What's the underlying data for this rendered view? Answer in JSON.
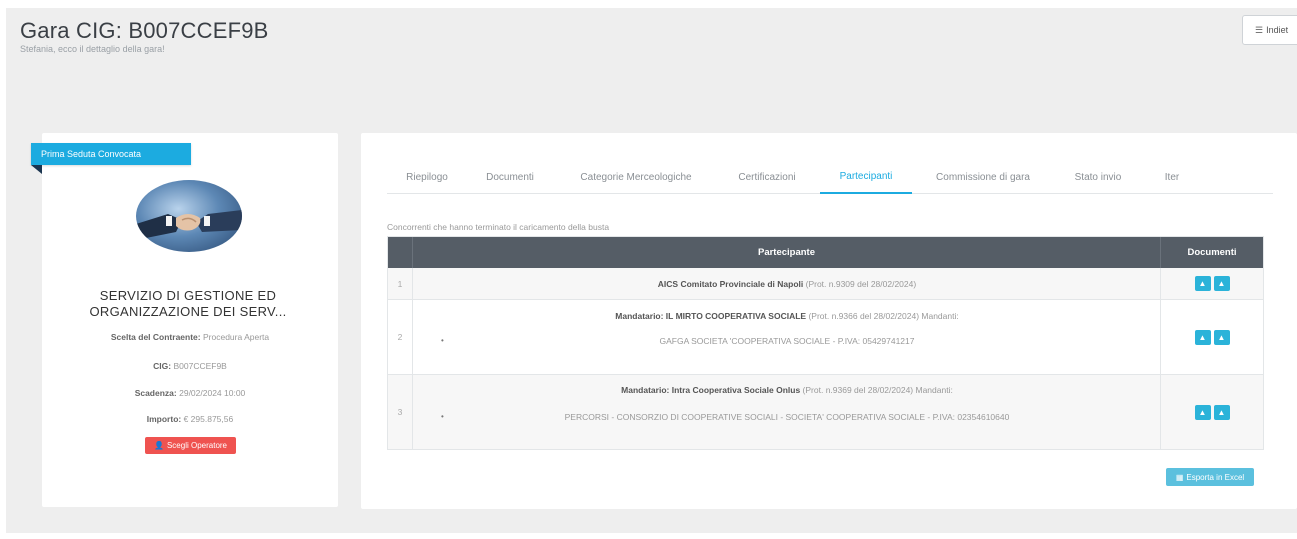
{
  "header": {
    "title": "Gara CIG: B007CCEF9B",
    "subtitle": "Stefania, ecco il dettaglio della gara!",
    "back_label": "Indiet",
    "back_icon": "list-icon"
  },
  "left_card": {
    "badge": "Prima Seduta Convocata",
    "service_title": "SERVIZIO DI GESTIONE ED ORGANIZZAZIONE DEI SERV...",
    "fields": [
      {
        "label": "Scelta del Contraente:",
        "value": "Procedura Aperta"
      },
      {
        "label": "CIG:",
        "value": "B007CCEF9B"
      },
      {
        "label": "Scadenza:",
        "value": "29/02/2024 10:00"
      },
      {
        "label": "Importo:",
        "value": "€ 295.875,56"
      }
    ],
    "action_label": "Scegli Operatore",
    "action_icon": "user-icon"
  },
  "tabs": [
    {
      "label": "Riepilogo",
      "active": false
    },
    {
      "label": "Documenti",
      "active": false
    },
    {
      "label": "Categorie Merceologiche",
      "active": false
    },
    {
      "label": "Certificazioni",
      "active": false
    },
    {
      "label": "Partecipanti",
      "active": true
    },
    {
      "label": "Commissione di gara",
      "active": false
    },
    {
      "label": "Stato invio",
      "active": false
    },
    {
      "label": "Iter",
      "active": false
    }
  ],
  "table": {
    "caption": "Concorrenti che hanno terminato il caricamento della busta",
    "headers": [
      "Partecipante",
      "Documenti"
    ],
    "rows": [
      {
        "num": "1",
        "main_bold": "AICS Comitato Provinciale di Napoli",
        "main_rest": " (Prot. n.9309 del 28/02/2024)"
      },
      {
        "num": "2",
        "main_bold": "Mandatario: IL MIRTO COOPERATIVA SOCIALE",
        "main_rest": " (Prot. n.9366 del 28/02/2024) Mandanti:",
        "sub": "GAFGA SOCIETA 'COOPERATIVA SOCIALE - P.IVA: 05429741217"
      },
      {
        "num": "3",
        "main_bold": "Mandatario: Intra Cooperativa Sociale Onlus",
        "main_rest": " (Prot. n.9369 del 28/02/2024) Mandanti:",
        "sub": "PERCORSI - CONSORZIO DI COOPERATIVE SOCIALI - SOCIETA' COOPERATIVA SOCIALE - P.IVA: 02354610640"
      }
    ],
    "download_icon": "download-icon"
  },
  "export_label": "Esporta in Excel",
  "colors": {
    "accent": "#1cabe0",
    "header_bg": "#555d66",
    "danger": "#ef5350",
    "info": "#5bc0de"
  }
}
